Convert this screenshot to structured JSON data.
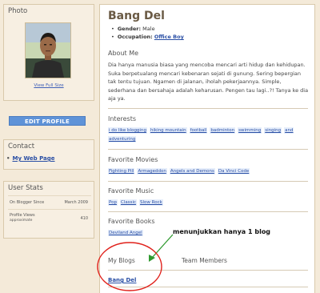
{
  "sidebar": {
    "photo": {
      "title": "Photo",
      "view_full": "View Full Size"
    },
    "edit_profile": "EDIT PROFILE",
    "contact": {
      "title": "Contact",
      "link": "My Web Page"
    },
    "stats": {
      "title": "User Stats",
      "rows": [
        {
          "label": "On Blogger Since",
          "value": "March 2009"
        },
        {
          "label": "Profile Views",
          "sublabel": "approximate",
          "value": "410"
        }
      ]
    }
  },
  "profile": {
    "name": "Bang Del",
    "gender_label": "Gender",
    "gender": "Male",
    "occupation_label": "Occupation",
    "occupation": "Office Boy"
  },
  "about": {
    "title": "About Me",
    "text": "Dia hanya manusia biasa yang mencoba mencari arti hidup dan kehidupan. Suka berpetualang mencari kebenaran sejati di gunung. Sering bepergian tak tentu tujuan. Ngamen di jalanan, iholah pekerjaannya. Simple, sederhana dan bersahaja adalah keharusan. Pengen tau lagi..?! Tanya ke dia aja ya."
  },
  "interests": {
    "title": "Interests",
    "items": [
      "i do like blogging",
      "hiking mountain",
      "football",
      "badminton",
      "swimming",
      "singing",
      "and",
      "adventuring"
    ]
  },
  "movies": {
    "title": "Favorite Movies",
    "items": [
      "Fighting Pill",
      "Armageddon",
      "Angels and Demons",
      "Da Vinci Code"
    ]
  },
  "music": {
    "title": "Favorite Music",
    "items": [
      "Pop",
      "Classic",
      "Slow Rock"
    ]
  },
  "books": {
    "title": "Favorite Books",
    "items": [
      "Deviland Angel"
    ]
  },
  "tabs": {
    "my_blogs": "My Blogs",
    "team_members": "Team Members"
  },
  "blog": {
    "name": "Bang Del"
  },
  "annotation": {
    "text": "menunjukkan hanya 1 blog"
  },
  "colors": {
    "background": "#f4ead9",
    "link": "#2a4fa5",
    "button": "#5f93d8",
    "annotation_circle": "#e0201a",
    "annotation_arrow": "#2f9a2f"
  }
}
